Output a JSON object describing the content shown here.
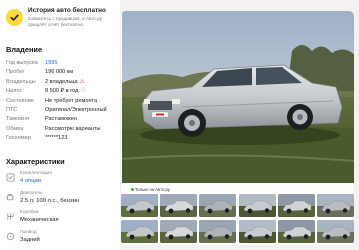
{
  "history": {
    "title": "История авто бесплатно",
    "subtitle": "Свяжитесь с продавцом, и Авто.ру пришлёт отчёт бесплатно"
  },
  "specs": {
    "heading": "Владение",
    "rows": [
      {
        "label": "Год выпуска",
        "value": "1995",
        "link": true
      },
      {
        "label": "Пробег",
        "value": "196 000 км",
        "link": false
      },
      {
        "label": "Владельцы",
        "value": "2 владельца",
        "link": false,
        "warn": true
      },
      {
        "label": "Налог",
        "value": "8 500 ₽ в год",
        "link": false,
        "info": true
      },
      {
        "label": "Состояние",
        "value": "Не требует ремонта",
        "link": false
      },
      {
        "label": "ПТС",
        "value": "Оригинал/Электронный",
        "link": false
      },
      {
        "label": "Таможня",
        "value": "Растаможен",
        "link": false
      },
      {
        "label": "Обмен",
        "value": "Рассмотрю варианты",
        "link": false
      },
      {
        "label": "Госномер",
        "value": "******123",
        "link": false
      }
    ]
  },
  "characteristics": {
    "heading": "Характеристики",
    "items": [
      {
        "label": "Комплектация",
        "value": "4 опции",
        "link": true,
        "icon": "equipment-icon"
      },
      {
        "label": "Двигатель",
        "value": "2.5 л, 100 л.с., бензин",
        "link": false,
        "icon": "engine-icon"
      },
      {
        "label": "Коробка",
        "value": "Механическая",
        "link": false,
        "icon": "gearbox-icon"
      },
      {
        "label": "Привод",
        "value": "Задний",
        "link": false,
        "icon": "drive-icon"
      }
    ]
  },
  "gallery": {
    "badge": "Только на Авто.ру",
    "thumb_count": 12
  }
}
